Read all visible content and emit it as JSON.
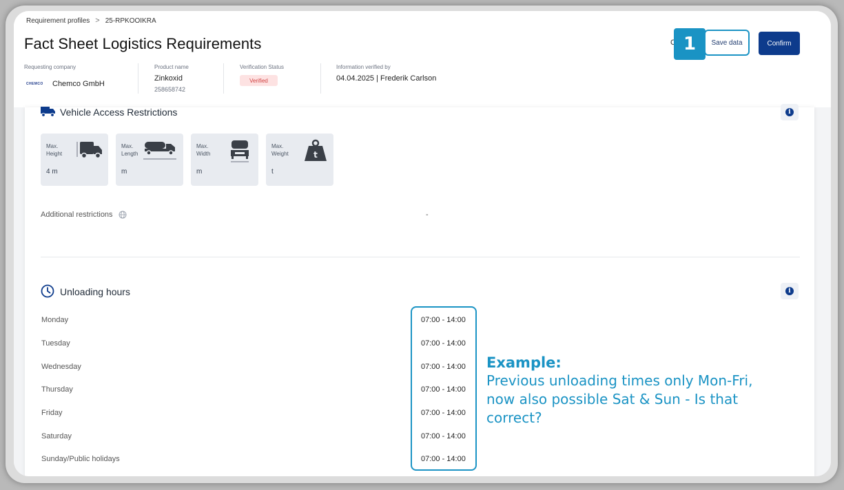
{
  "breadcrumb": {
    "parent": "Requirement profiles",
    "separator": ">",
    "current": "25-RPKOOIKRA"
  },
  "page": {
    "title": "Fact Sheet Logistics Requirements"
  },
  "toolbar": {
    "cut_label": "C",
    "callout_number": "1",
    "save_label": "Save data",
    "confirm_label": "Confirm"
  },
  "meta": {
    "requesting_company_label": "Requesting company",
    "company_logo_text": "CHEMCO",
    "company_name": "Chemco GmbH",
    "product_name_label": "Product name",
    "product_name": "Zinkoxid",
    "product_number": "258658742",
    "verification_label": "Verification Status",
    "verification_status": "Verified",
    "verified_by_label": "Information verified by",
    "verified_by_value": "04.04.2025 | Frederik Carlson"
  },
  "vehicle": {
    "title": "Vehicle Access Restrictions",
    "tiles": [
      {
        "label_line1": "Max.",
        "label_line2": "Height",
        "value": "4 m",
        "icon": "truck-height-icon"
      },
      {
        "label_line1": "Max.",
        "label_line2": "Length",
        "value": "m",
        "icon": "truck-length-icon"
      },
      {
        "label_line1": "Max.",
        "label_line2": "Width",
        "value": "m",
        "icon": "truck-width-icon"
      },
      {
        "label_line1": "Max.",
        "label_line2": "Weight",
        "value": "t",
        "icon": "weight-icon"
      }
    ],
    "additional_label": "Additional restrictions",
    "additional_value": "-"
  },
  "unloading": {
    "title": "Unloading hours",
    "days": [
      {
        "day": "Monday",
        "hours": "07:00 - 14:00"
      },
      {
        "day": "Tuesday",
        "hours": "07:00 - 14:00"
      },
      {
        "day": "Wednesday",
        "hours": "07:00 - 14:00"
      },
      {
        "day": "Thursday",
        "hours": "07:00 - 14:00"
      },
      {
        "day": "Friday",
        "hours": "07:00 - 14:00"
      },
      {
        "day": "Saturday",
        "hours": "07:00 - 14:00"
      },
      {
        "day": "Sunday/Public holidays",
        "hours": "07:00 - 14:00"
      }
    ]
  },
  "annotation": {
    "title": "Example:",
    "text": "Previous unloading times only Mon-Fri, now also possible Sat & Sun - Is that correct?"
  },
  "colors": {
    "primary": "#0d3b8c",
    "callout": "#1a93c4",
    "verified_bg": "#fde2e2",
    "verified_text": "#d14343",
    "tile_bg": "#e8ebf0"
  }
}
